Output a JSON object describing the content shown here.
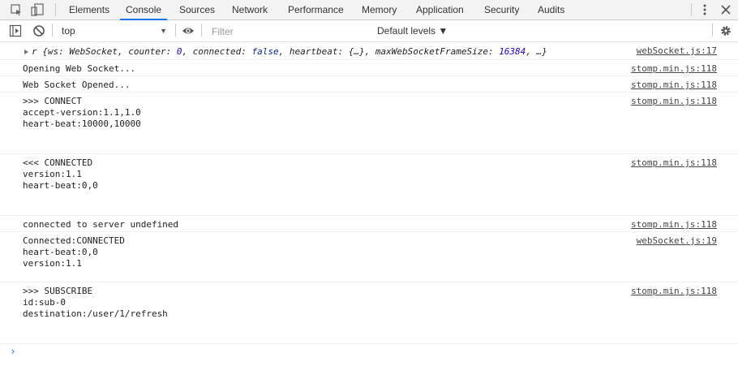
{
  "tabs": [
    "Elements",
    "Console",
    "Sources",
    "Network",
    "Performance",
    "Memory",
    "Application",
    "Security",
    "Audits"
  ],
  "active_tab": "Console",
  "toolbar": {
    "context": "top",
    "filter_placeholder": "Filter",
    "levels_label": "Default levels ▼"
  },
  "messages": [
    {
      "text": "r {ws: WebSocket, counter: 0, connected: false, heartbeat: {…}, maxWebSocketFrameSize: 16384, …}",
      "source": "webSocket.js:17"
    },
    {
      "text": "Opening Web Socket...",
      "source": "stomp.min.js:118"
    },
    {
      "text": "Web Socket Opened...",
      "source": "stomp.min.js:118"
    },
    {
      "text": ">>> CONNECT\naccept-version:1.1,1.0\nheart-beat:10000,10000",
      "source": "stomp.min.js:118"
    },
    {
      "text": "<<< CONNECTED\nversion:1.1\nheart-beat:0,0",
      "source": "stomp.min.js:118"
    },
    {
      "text": "connected to server undefined",
      "source": "stomp.min.js:118"
    },
    {
      "text": "Connected:CONNECTED\nheart-beat:0,0\nversion:1.1",
      "source": "webSocket.js:19"
    },
    {
      "text": ">>> SUBSCRIBE\nid:sub-0\ndestination:/user/1/refresh",
      "source": "stomp.min.js:118"
    }
  ],
  "obj_parts": {
    "prefix": "r {ws: WebSocket, counter: ",
    "counter": "0",
    "mid1": ", connected: ",
    "connected": "false",
    "mid2": ", heartbeat: {…}, maxWebSocketFrameSize: ",
    "frame": "16384",
    "suffix": ", …}"
  },
  "prompt": "›"
}
